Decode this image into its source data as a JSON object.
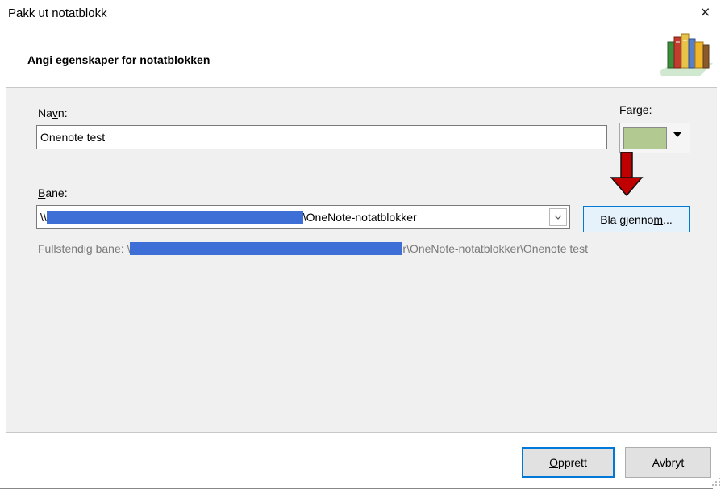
{
  "window": {
    "title": "Pakk ut notatblokk",
    "close_icon": "×"
  },
  "header": {
    "title": "Angi egenskaper for notatblokken"
  },
  "form": {
    "name_label_pre": "Na",
    "name_label_access": "v",
    "name_label_post": "n:",
    "name_value": "Onenote test",
    "color_label_access": "F",
    "color_label_post": "arge:",
    "color_value": "#b3c992",
    "path_label_access": "B",
    "path_label_post": "ane:",
    "path_prefix": "\\\\",
    "path_suffix": "\\OneNote-notatblokker",
    "browse_label_pre": "Bla gjenno",
    "browse_label_access": "m",
    "browse_label_post": "...",
    "full_path_prefix": "Fullstendig bane: \\",
    "full_path_suffix": "r\\OneNote-notatblokker\\Onenote test"
  },
  "buttons": {
    "ok_access": "O",
    "ok_rest": "pprett",
    "cancel": "Avbryt"
  },
  "colors": {
    "accent": "#0078d7",
    "redaction": "#3e6fd6",
    "annotation_arrow": "#c00000"
  }
}
